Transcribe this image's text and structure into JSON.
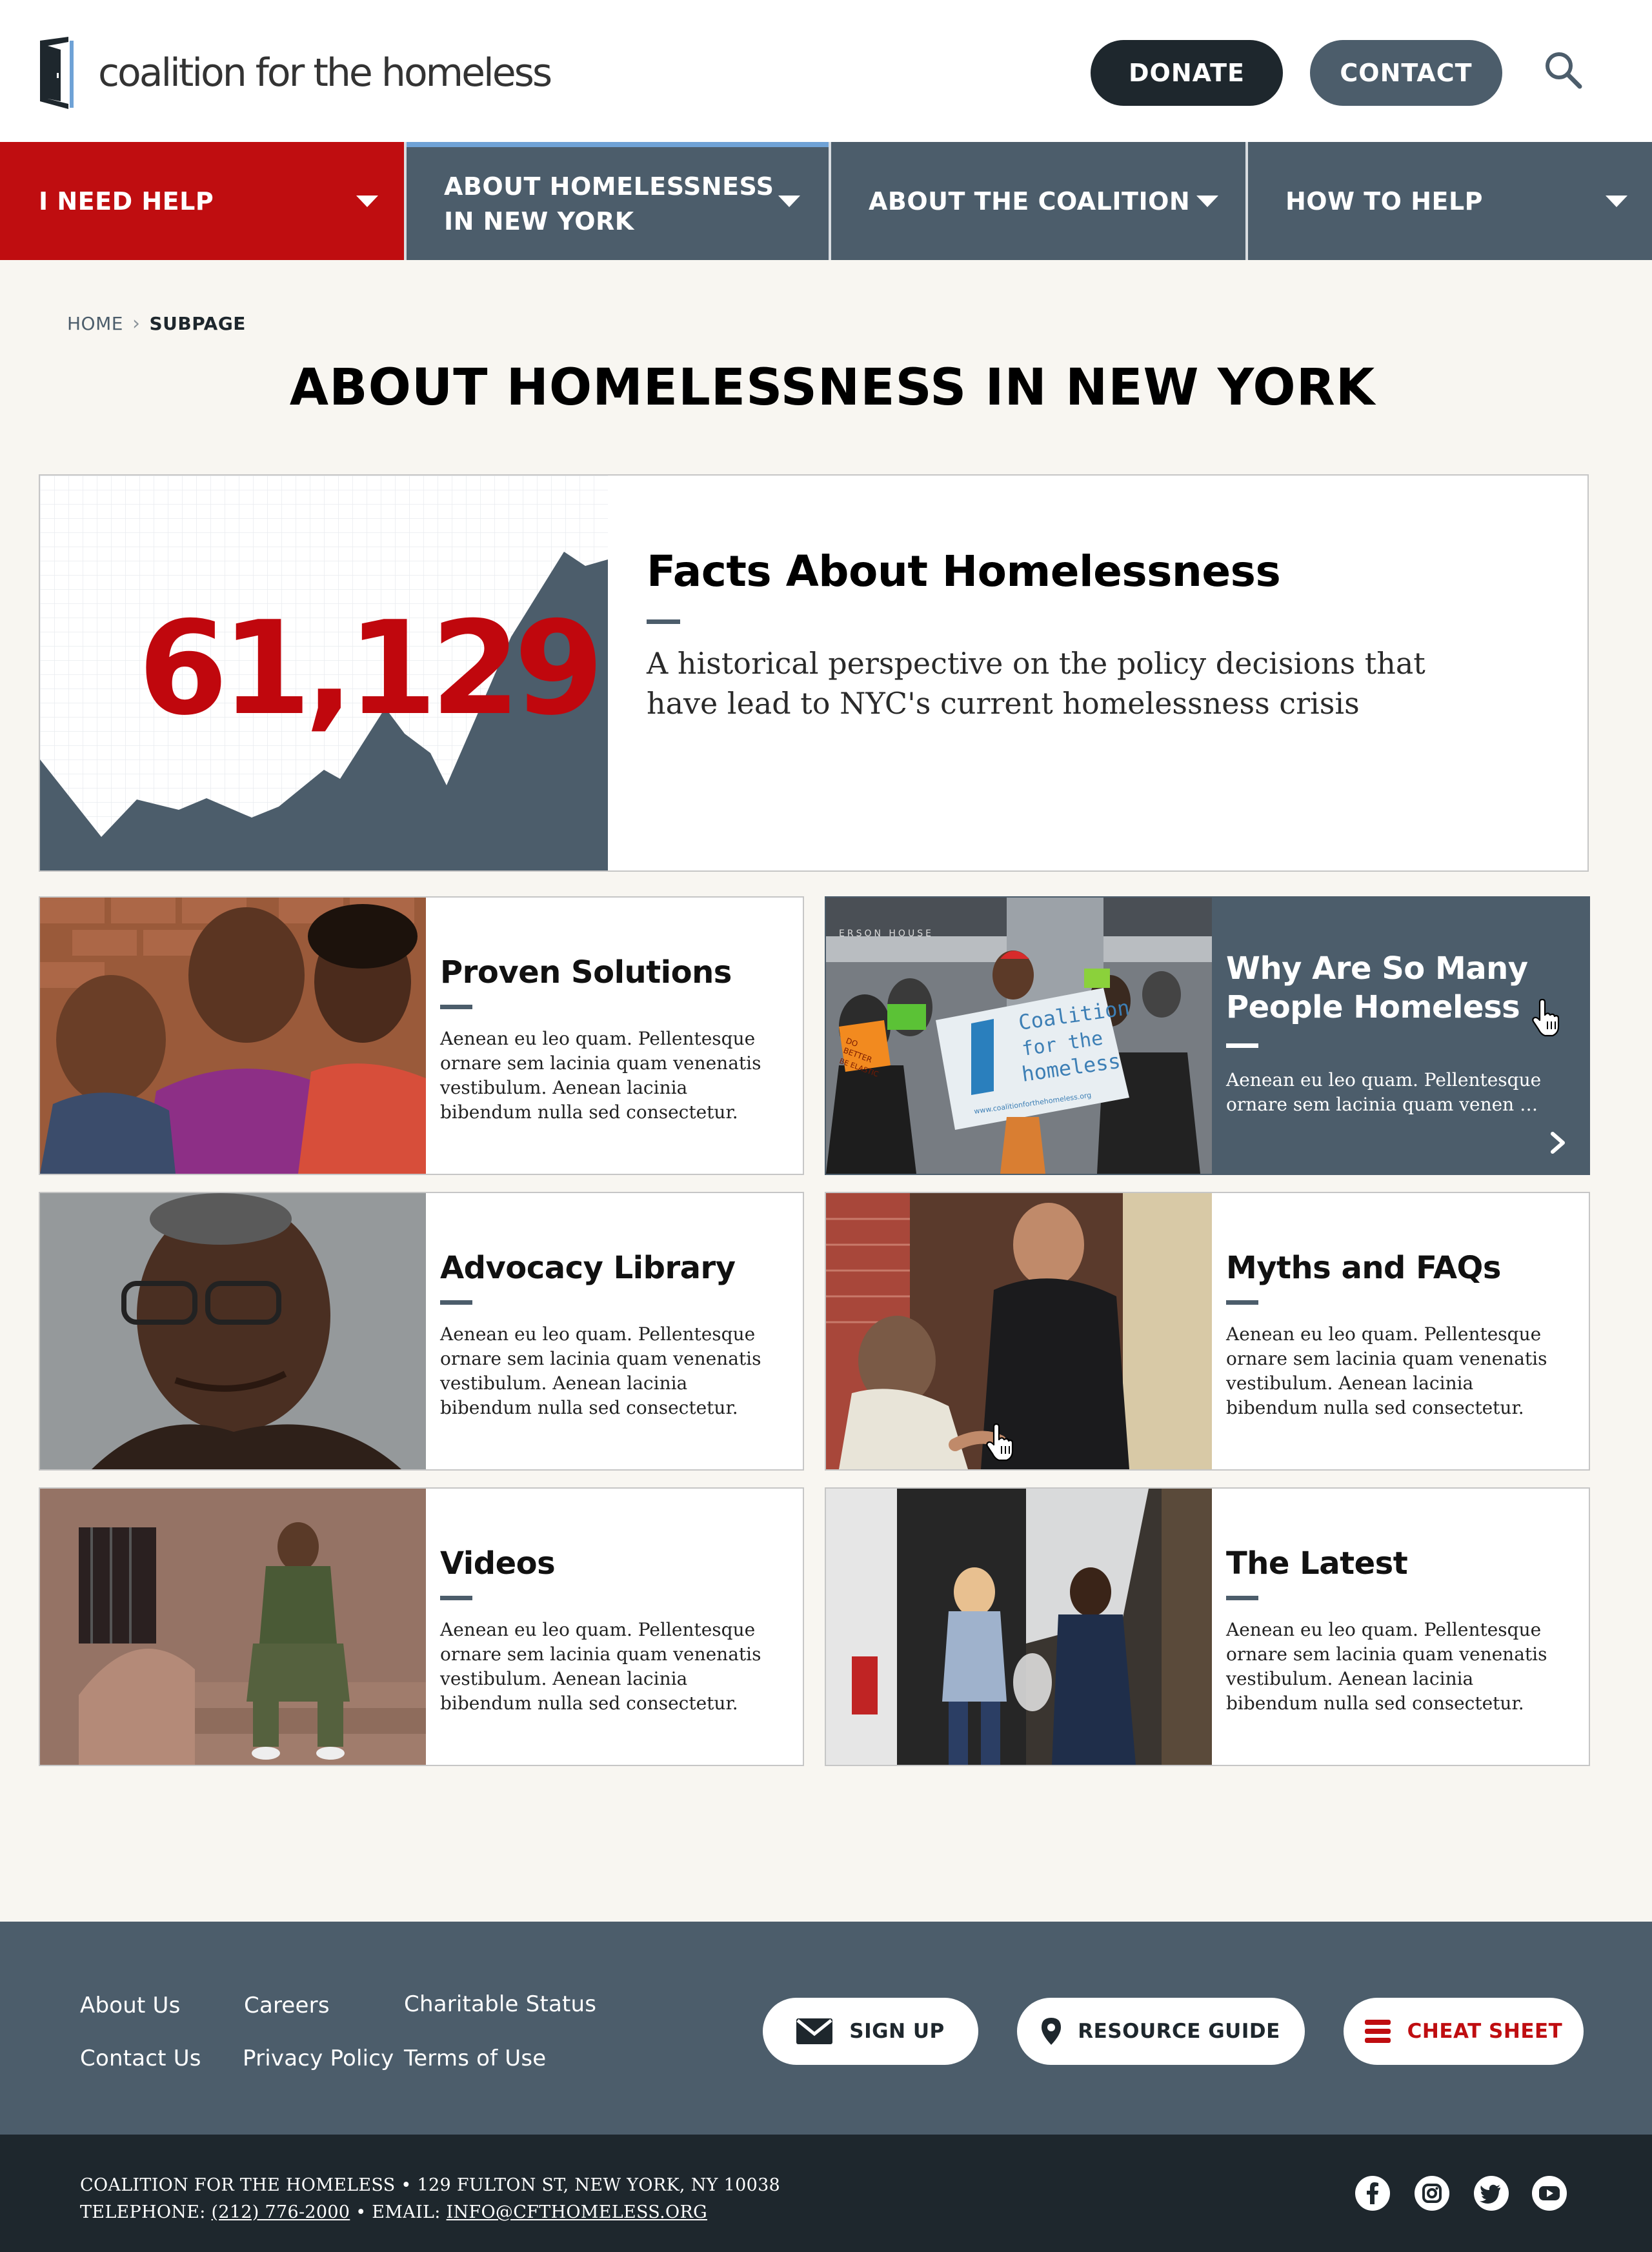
{
  "header": {
    "logo_text": "coalition for the homeless",
    "donate_label": "DONATE",
    "contact_label": "CONTACT"
  },
  "nav": [
    {
      "label": "I NEED HELP"
    },
    {
      "label_line1": "ABOUT HOMELESSNESS",
      "label_line2": "IN NEW YORK"
    },
    {
      "label": "ABOUT THE COALITION"
    },
    {
      "label": "HOW TO HELP"
    }
  ],
  "breadcrumb": {
    "home": "HOME",
    "current": "SUBPAGE"
  },
  "page_title": "ABOUT HOMELESSNESS IN NEW YORK",
  "facts": {
    "number": "61,129",
    "heading": "Facts About Homelessness",
    "description": "A historical perspective on the policy decisions that have lead to NYC's current homelessness crisis"
  },
  "cards": [
    {
      "title": "Proven Solutions",
      "text": "Aenean eu leo quam. Pellentesque ornare sem lacinia quam venenatis vestibulum. Aenean lacinia bibendum nulla sed consectetur."
    },
    {
      "title": "Why Are So Many People Homeless",
      "text": "Aenean eu leo quam. Pellentesque ornare sem lacinia quam venen …"
    },
    {
      "title": "Advocacy Library",
      "text": "Aenean eu leo quam. Pellentesque ornare sem lacinia quam venenatis vestibulum. Aenean lacinia bibendum nulla sed consectetur."
    },
    {
      "title": "Myths and FAQs",
      "text": "Aenean eu leo quam. Pellentesque ornare sem lacinia quam venenatis vestibulum. Aenean lacinia bibendum nulla sed consectetur."
    },
    {
      "title": "Videos",
      "text": "Aenean eu leo quam. Pellentesque ornare sem lacinia quam venenatis vestibulum. Aenean lacinia bibendum nulla sed consectetur."
    },
    {
      "title": "The Latest",
      "text": "Aenean eu leo quam. Pellentesque ornare sem lacinia quam venenatis vestibulum. Aenean lacinia bibendum nulla sed consectetur."
    }
  ],
  "photo_banner": {
    "line1": "Coalition",
    "line2": "for the",
    "line3": "homeless",
    "url": "www.coalitionforthehomeless.org",
    "sign": "BETTER",
    "sign2": "DO",
    "sign3": "BE ELASTIC",
    "building": "ERSON HOUSE"
  },
  "footer": {
    "links": [
      "About Us",
      "Careers",
      "Charitable Status",
      "Contact Us",
      "Privacy Policy",
      "Terms of Use"
    ],
    "signup_label": "SIGN UP",
    "resource_label": "RESOURCE GUIDE",
    "cheat_label": "CHEAT SHEET",
    "address_line": "COALITION FOR THE HOMELESS • 129 FULTON ST, NEW YORK, NY 10038",
    "telephone_prefix": "TELEPHONE:",
    "telephone": "(212) 776-2000",
    "email_prefix": "• EMAIL:",
    "email": "INFO@CFTHOMELESS.ORG"
  },
  "colors": {
    "brand_red": "#bf0d10",
    "slate": "#4c5d6b",
    "dark": "#1e272d",
    "nav_highlight": "#6fa2d6",
    "page_bg": "#f8f6f1"
  },
  "icons": [
    "door-logo-icon",
    "search-icon",
    "caret-down-icon",
    "chevron-right-icon",
    "hand-cursor-icon",
    "envelope-icon",
    "map-pin-icon",
    "list-icon",
    "facebook-icon",
    "instagram-icon",
    "twitter-icon",
    "youtube-icon"
  ]
}
